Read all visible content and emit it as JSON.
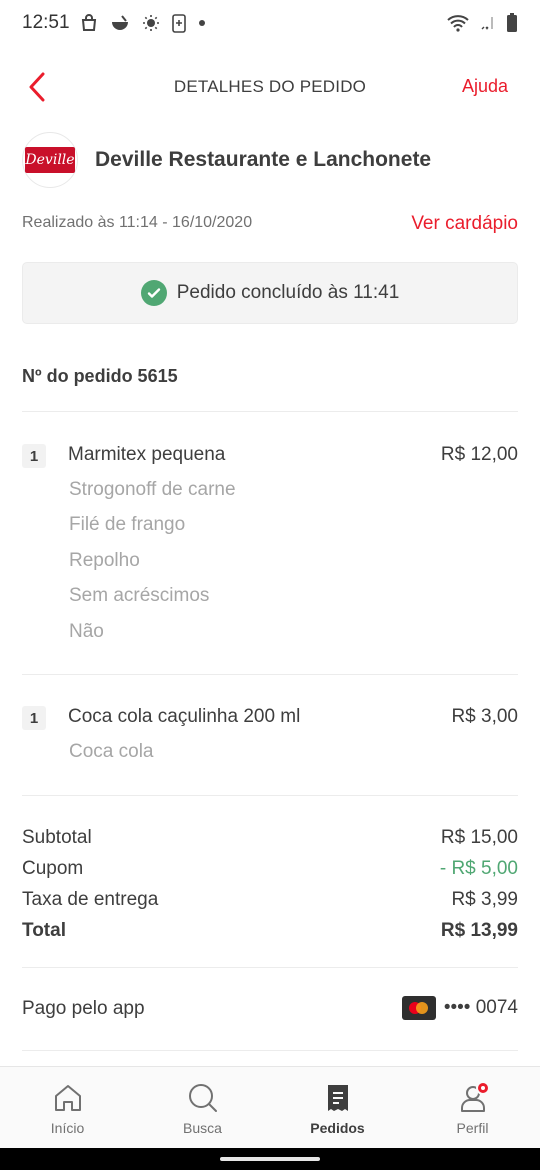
{
  "status_bar": {
    "time": "12:51"
  },
  "header": {
    "title": "DETALHES DO PEDIDO",
    "help_label": "Ajuda"
  },
  "restaurant": {
    "logo_text": "Deville",
    "name": "Deville Restaurante e Lanchonete"
  },
  "order_meta": {
    "placed_text": "Realizado às 11:14 - 16/10/2020",
    "menu_link": "Ver cardápio"
  },
  "status_card": {
    "text": "Pedido concluído às 11:41"
  },
  "order_number": "Nº do pedido 5615",
  "items": [
    {
      "qty": "1",
      "name": "Marmitex pequena",
      "price": "R$ 12,00",
      "options": [
        "Strogonoff de carne",
        "Filé de frango",
        "Repolho",
        "Sem acréscimos",
        "Não"
      ]
    },
    {
      "qty": "1",
      "name": "Coca cola caçulinha 200 ml",
      "price": "R$ 3,00",
      "options": [
        "Coca cola"
      ]
    }
  ],
  "totals": {
    "subtotal_label": "Subtotal",
    "subtotal_value": "R$ 15,00",
    "coupon_label": "Cupom",
    "coupon_value": "- R$ 5,00",
    "delivery_label": "Taxa de entrega",
    "delivery_value": "R$ 3,99",
    "total_label": "Total",
    "total_value": "R$ 13,99"
  },
  "payment": {
    "label": "Pago pelo app",
    "card_digits": "•••• 0074",
    "card_brand_icon": "mastercard-icon"
  },
  "bottom_nav": [
    {
      "label": "Início",
      "icon": "home-icon"
    },
    {
      "label": "Busca",
      "icon": "search-icon"
    },
    {
      "label": "Pedidos",
      "icon": "orders-icon",
      "active": true
    },
    {
      "label": "Perfil",
      "icon": "profile-icon"
    }
  ],
  "colors": {
    "brand_red": "#ea1d2c",
    "success_green": "#50a773",
    "muted_text": "#a6a6a6"
  }
}
